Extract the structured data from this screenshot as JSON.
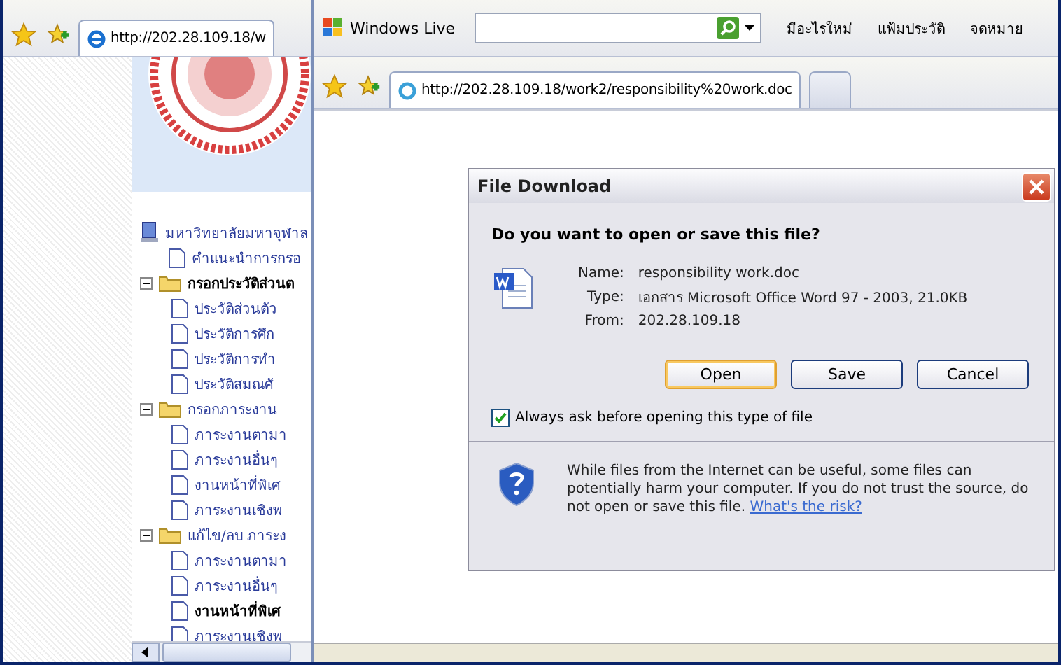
{
  "left_browser": {
    "tab": {
      "url": "http://202.28.109.18/w",
      "selected": true
    },
    "tree": {
      "label": "มหาวิทยาลัยมหาจุฬาล",
      "children": [
        {
          "label": "คำแนะนำการกรอ",
          "bold": false
        },
        {
          "label": "กรอกประวัติส่วนต",
          "bold": true,
          "expanded": true,
          "children": [
            {
              "label": "ประวัติส่วนตัว",
              "bold": false
            },
            {
              "label": "ประวัติการศึก",
              "bold": false
            },
            {
              "label": "ประวัติการทำ",
              "bold": false
            },
            {
              "label": "ประวัติสมณศั",
              "bold": false
            }
          ]
        },
        {
          "label": "กรอกภาระงาน",
          "bold": false,
          "expanded": true,
          "children": [
            {
              "label": "ภาระงานตามา",
              "bold": false
            },
            {
              "label": "ภาระงานอื่นๆ",
              "bold": false
            },
            {
              "label": "งานหน้าที่พิเศ",
              "bold": false
            },
            {
              "label": "ภาระงานเชิงพ",
              "bold": false
            }
          ]
        },
        {
          "label": "แก้ไข/ลบ ภาระง",
          "bold": false,
          "expanded": true,
          "children": [
            {
              "label": "ภาระงานตามา",
              "bold": false
            },
            {
              "label": "ภาระงานอื่นๆ",
              "bold": false
            },
            {
              "label": "งานหน้าที่พิเศ",
              "bold": true
            },
            {
              "label": "ภาระงานเชิงพ",
              "bold": false
            }
          ]
        }
      ]
    }
  },
  "right_browser": {
    "brand": "Windows Live",
    "menu": [
      "มีอะไรใหม่",
      "แฟ้มประวัติ",
      "จดหมาย"
    ],
    "tabs": [
      {
        "url": "http://202.28.109.18/work2/responsibility%20work.doc",
        "selected": true
      },
      {
        "selected": false
      }
    ]
  },
  "dialog": {
    "title": "File Download",
    "question": "Do you want to open or save this file?",
    "fields": [
      {
        "label": "Name:",
        "value": "responsibility work.doc"
      },
      {
        "label": "Type:",
        "value": "เอกสาร Microsoft Office Word 97 - 2003, 21.0KB"
      },
      {
        "label": "From:",
        "value": "202.28.109.18"
      }
    ],
    "buttons": [
      {
        "label": "Open",
        "selected": true
      },
      {
        "label": "Save",
        "selected": false
      },
      {
        "label": "Cancel",
        "selected": false
      }
    ],
    "always_ask": {
      "label": "Always ask before opening this type of file",
      "checked": true
    },
    "warning": "While files from the Internet can be useful, some files can potentially harm your computer. If you do not trust the source, do not open or save this file.",
    "risk_link": "What's the risk?"
  }
}
